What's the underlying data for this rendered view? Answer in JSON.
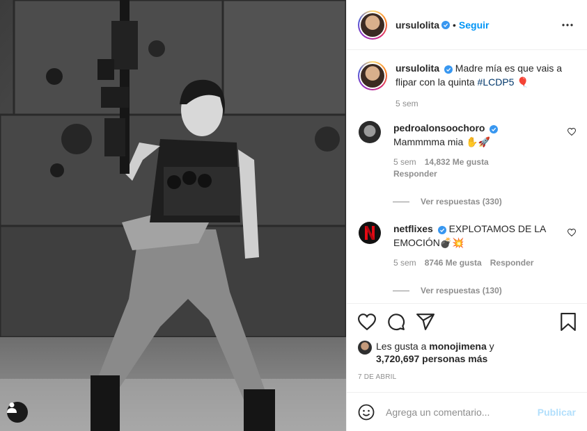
{
  "post": {
    "author": "ursulolita",
    "follow_label": "Seguir",
    "caption_text": "Madre mía es que vais a flipar con la quinta ",
    "caption_hashtag": "#LCDP5",
    "caption_emoji": "🎈",
    "caption_time": "5 sem"
  },
  "comments": [
    {
      "user": "pedroalonsoochoro",
      "text": "Mammmma mia ✋🚀",
      "time": "5 sem",
      "likes": "14,832 Me gusta",
      "reply": "Responder",
      "view_replies": "Ver respuestas (330)"
    },
    {
      "user": "netflixes",
      "text": "EXPLOTAMOS DE LA EMOCIÓN💣💥",
      "time": "5 sem",
      "likes": "8746 Me gusta",
      "reply": "Responder",
      "view_replies": "Ver respuestas (130)"
    }
  ],
  "likes": {
    "prefix": "Les gusta a ",
    "user": "monojimena",
    "mid": " y",
    "count": "3,720,697 personas más"
  },
  "date": "7 DE ABRIL",
  "add_comment": {
    "placeholder": "Agrega un comentario...",
    "publish_label": "Publicar"
  },
  "colors": {
    "accent": "#0095f6",
    "verified": "#3897f0",
    "muted": "#8e8e8e",
    "netflix": "#e50914"
  }
}
